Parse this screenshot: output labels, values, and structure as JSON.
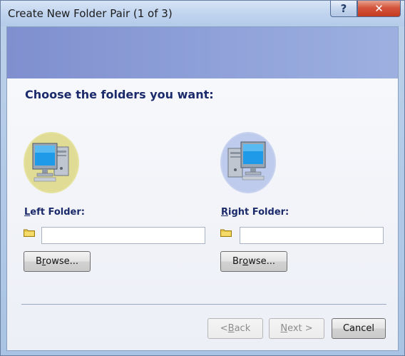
{
  "window": {
    "title": "Create New Folder Pair (1 of 3)",
    "help_label": "?",
    "close_label": "✕"
  },
  "main": {
    "heading": "Choose the folders you want:",
    "left": {
      "label_mnemonic": "L",
      "label_rest": "eft Folder:",
      "path_value": "",
      "browse_mnemonic_pre": "B",
      "browse_mnemonic": "r",
      "browse_rest": "owse..."
    },
    "right": {
      "label_mnemonic": "R",
      "label_rest": "ight Folder:",
      "path_value": "",
      "browse_pre": "Br",
      "browse_mnemonic": "o",
      "browse_rest": "wse..."
    }
  },
  "footer": {
    "back_pre": "< ",
    "back_mnemonic": "B",
    "back_rest": "ack",
    "next_mnemonic": "N",
    "next_rest": "ext >",
    "cancel_label": "Cancel"
  },
  "colors": {
    "accent_heading": "#1b2a6b",
    "banner": "#8ea0d8",
    "close_button": "#c43a1f"
  },
  "icons": {
    "left_computer": "computer-icon",
    "right_computer": "computer-icon",
    "folder": "folder-icon"
  }
}
